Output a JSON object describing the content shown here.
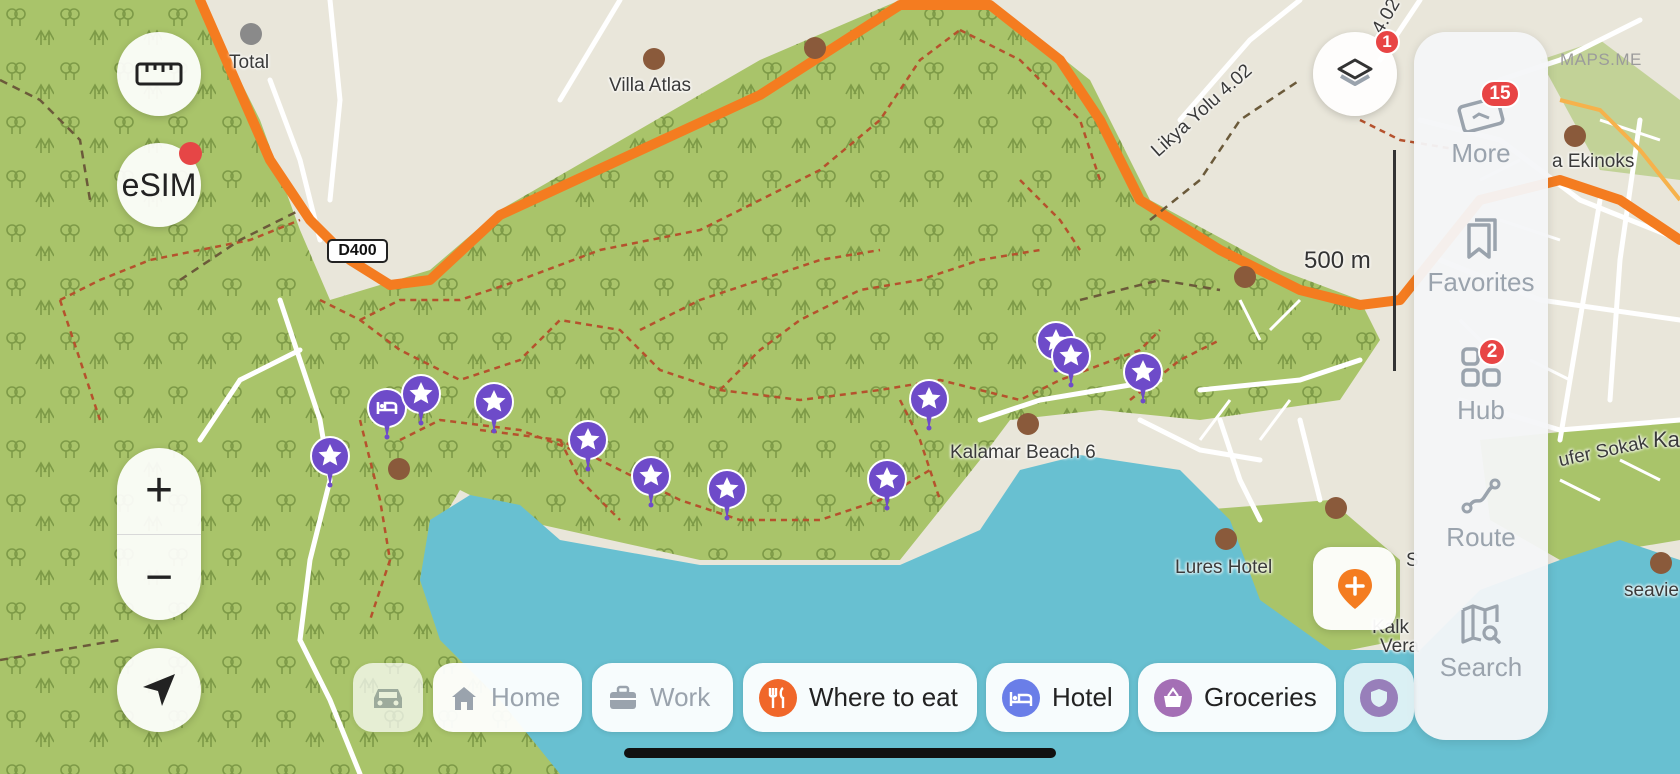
{
  "map": {
    "labels": {
      "total": "Total",
      "villa_atlas": "Villa Atlas",
      "road_d400": "D400",
      "likya_yolu": "Likya Yolu 4.02",
      "likya_yolu_top": "4.02",
      "ekinoks": "a Ekinoks",
      "kalamar_beach": "Kalamar Beach 6",
      "lures_hotel": "Lures Hotel",
      "sufer_sokak": "ufer Sokak",
      "ka": "Ka",
      "seaview": "seavie",
      "kalk": "Kalk",
      "vera": "Vera",
      "s_cut": "S"
    },
    "watermark": "MAPS.ME",
    "scale_label": "500 m"
  },
  "left_controls": {
    "ruler_icon": "ruler-icon",
    "esim_label": "eSIM",
    "zoom_in_label": "+",
    "zoom_out_label": "−",
    "location_icon": "navigation-arrow-icon"
  },
  "layers": {
    "badge_count": "1",
    "icon": "layers-icon"
  },
  "right_panel": {
    "more": {
      "label": "More",
      "badge": "15",
      "icon": "ticket-icon"
    },
    "favorites": {
      "label": "Favorites",
      "icon": "bookmark-icon"
    },
    "hub": {
      "label": "Hub",
      "badge": "2",
      "icon": "grid-icon"
    },
    "route": {
      "label": "Route",
      "icon": "route-icon"
    },
    "search": {
      "label": "Search",
      "icon": "map-search-icon"
    }
  },
  "chips": {
    "car_icon": "car-icon",
    "home": "Home",
    "work": "Work",
    "where_to_eat": "Where to eat",
    "hotel": "Hotel",
    "groceries": "Groceries"
  },
  "colors": {
    "forest": "#a9c46a",
    "sea": "#68c0d1",
    "land": "#e9e6da",
    "highway": "#f47c20",
    "pin_purple": "#6e4bc9",
    "eat_orange": "#f0672a",
    "hotel_blue": "#6a7ee8",
    "groceries_purple": "#a46fb5",
    "badge_red": "#e84545"
  }
}
